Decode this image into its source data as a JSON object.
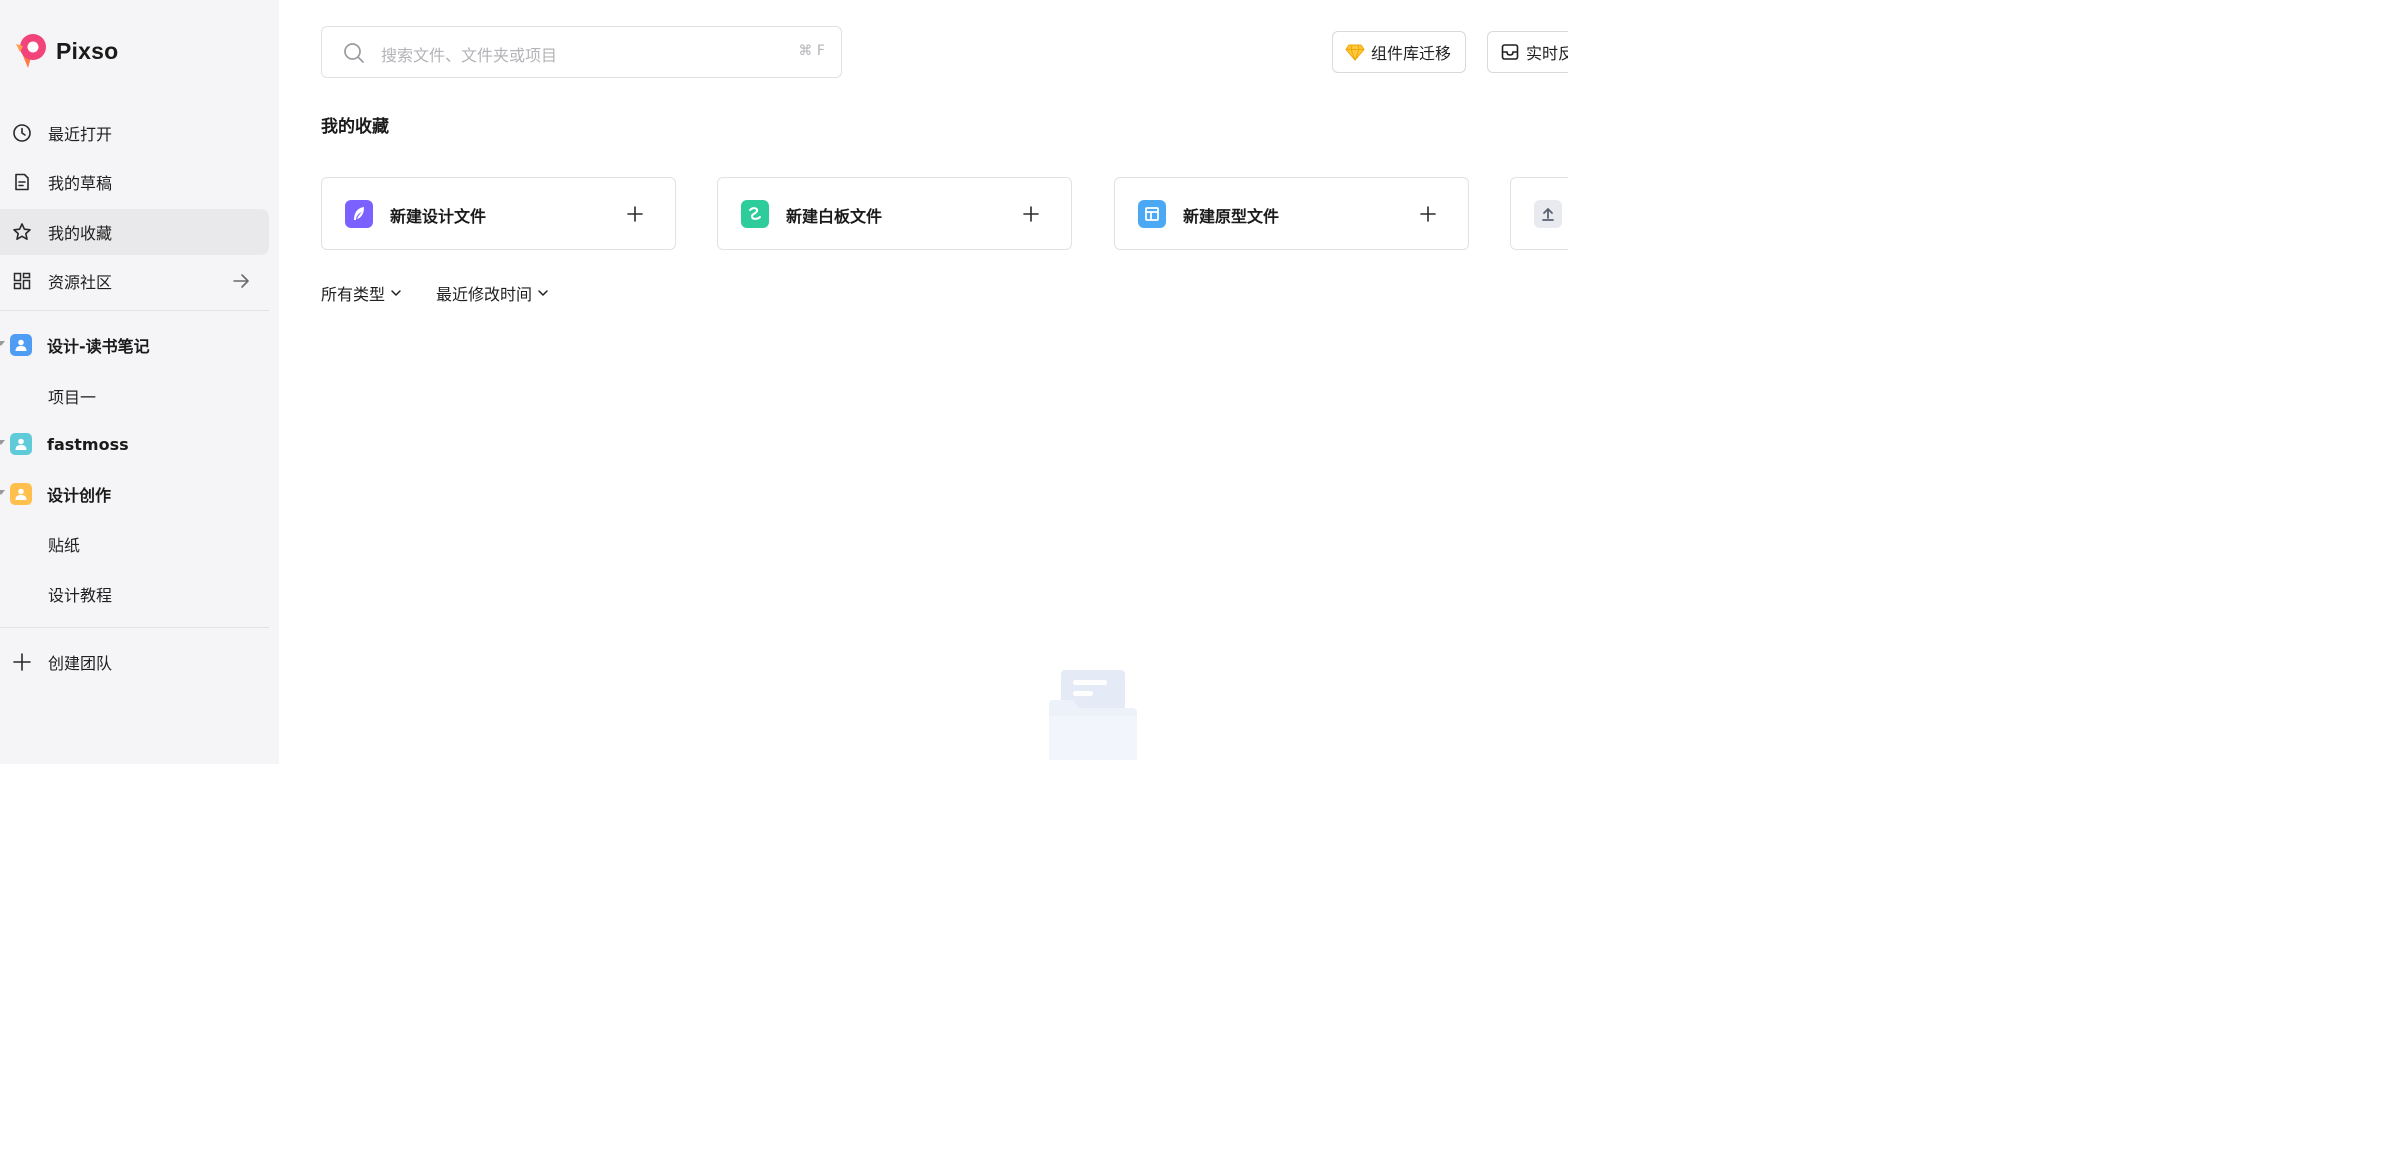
{
  "app": {
    "name": "Pixso"
  },
  "sidebar": {
    "nav": [
      {
        "label": "最近打开",
        "icon": "clock-icon"
      },
      {
        "label": "我的草稿",
        "icon": "draft-icon"
      },
      {
        "label": "我的收藏",
        "icon": "star-icon",
        "active": true
      },
      {
        "label": "资源社区",
        "icon": "grid-icon"
      }
    ],
    "teams": [
      {
        "name": "设计-读书笔记",
        "color": "#4f9cf5",
        "projects": [
          "项目一"
        ]
      },
      {
        "name": "fastmoss",
        "color": "#5fcbd8",
        "projects": []
      },
      {
        "name": "设计创作",
        "color": "#ffbf4d",
        "projects": [
          "贴纸",
          "设计教程"
        ]
      }
    ],
    "create_team": "创建团队"
  },
  "header": {
    "search": {
      "placeholder": "搜索文件、文件夹或项目",
      "shortcut": "⌘ F"
    },
    "buttons": [
      {
        "label": "组件库迁移",
        "icon": "diamond-icon"
      },
      {
        "label": "实时反",
        "icon": "inbox-icon"
      }
    ]
  },
  "main": {
    "title": "我的收藏",
    "cards": [
      {
        "label": "新建设计文件",
        "icon": "feather-icon",
        "color": "#7b61ff"
      },
      {
        "label": "新建白板文件",
        "icon": "whiteboard-icon",
        "color": "#2ecc9a"
      },
      {
        "label": "新建原型文件",
        "icon": "prototype-icon",
        "color": "#4aa8f5"
      },
      {
        "label": "",
        "icon": "upload-icon",
        "color": "#e8eaef"
      }
    ],
    "filters": [
      {
        "label": "所有类型"
      },
      {
        "label": "最近修改时间"
      }
    ]
  }
}
